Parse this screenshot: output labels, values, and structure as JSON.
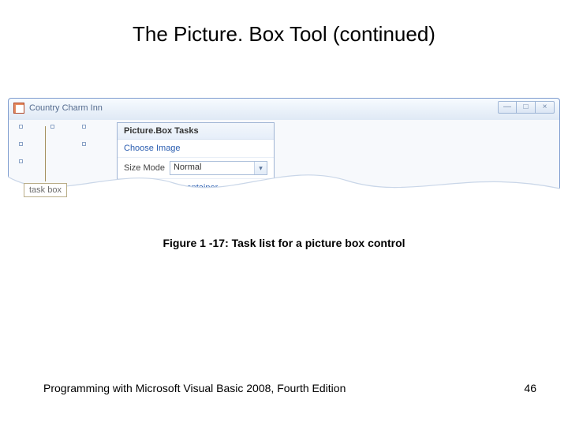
{
  "slide": {
    "title": "The Picture. Box Tool (continued)",
    "caption": "Figure 1 -17: Task list for a picture box control",
    "footer_text": "Programming with Microsoft Visual Basic 2008, Fourth Edition",
    "page_number": "46",
    "callout_label": "task box"
  },
  "window": {
    "title": "Country Charm Inn",
    "buttons": {
      "minimize": "—",
      "maximize": "□",
      "close": "×"
    }
  },
  "taskpanel": {
    "header": "Picture.Box Tasks",
    "choose_image": "Choose Image",
    "size_mode_label": "Size Mode",
    "size_mode_value": "Normal",
    "dock_link": "Dock in parent container"
  }
}
